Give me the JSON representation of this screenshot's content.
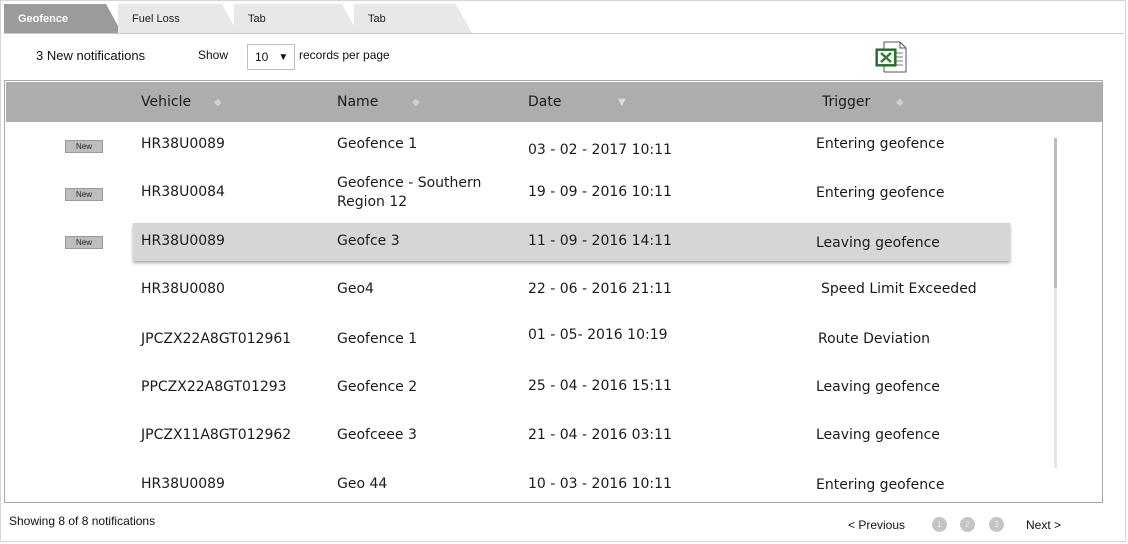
{
  "tabs": [
    {
      "label": "Geofence",
      "active": true
    },
    {
      "label": "Fuel Loss",
      "active": false
    },
    {
      "label": "Tab",
      "active": false
    },
    {
      "label": "Tab",
      "active": false
    }
  ],
  "toolbar": {
    "notifications": "3 New notifications",
    "show_label": "Show",
    "page_size": "10",
    "records_label": "records per page",
    "export_icon": "excel-export-icon"
  },
  "table": {
    "columns": [
      "Vehicle",
      "Name",
      "Date",
      "Trigger"
    ],
    "sorted_column": "Date",
    "new_badge": "New",
    "rows": [
      {
        "new": true,
        "vehicle": "HR38U0089",
        "name": "Geofence 1",
        "date": "03 - 02 -  2017  10:11",
        "trigger": "Entering geofence"
      },
      {
        "new": true,
        "vehicle": "HR38U0084",
        "name": "Geofence  - Southern Region 12",
        "date": "19 - 09 -  2016   10:11",
        "trigger": "Entering geofence"
      },
      {
        "new": true,
        "vehicle": "HR38U0089",
        "name": "Geofce 3",
        "date": "11 - 09 -  2016   14:11",
        "trigger": "Leaving geofence",
        "selected": true
      },
      {
        "new": false,
        "vehicle": "HR38U0080",
        "name": "Geo4",
        "date": "22 - 06 -  2016   21:11",
        "trigger": "Speed Limit Exceeded"
      },
      {
        "new": false,
        "vehicle": "JPCZX22A8GT012961",
        "name": "Geofence 1",
        "date": "01 - 05-  2016   10:19",
        "trigger": "Route Deviation"
      },
      {
        "new": false,
        "vehicle": "PPCZX22A8GT01293",
        "name": "Geofence 2",
        "date": "25 - 04 -  2016   15:11",
        "trigger": "Leaving geofence"
      },
      {
        "new": false,
        "vehicle": "JPCZX11A8GT012962",
        "name": "Geofceee 3",
        "date": "21 - 04 -  2016   03:11",
        "trigger": "Leaving geofence"
      },
      {
        "new": false,
        "vehicle": "HR38U0089",
        "name": "Geo 44",
        "date": "10 - 03 -  2016   10:11",
        "trigger": "Entering geofence"
      }
    ]
  },
  "footer": {
    "status": "Showing 8 of 8 notifications",
    "previous": "< Previous",
    "pages": [
      "1",
      "2",
      "3"
    ],
    "next": "Next >"
  }
}
